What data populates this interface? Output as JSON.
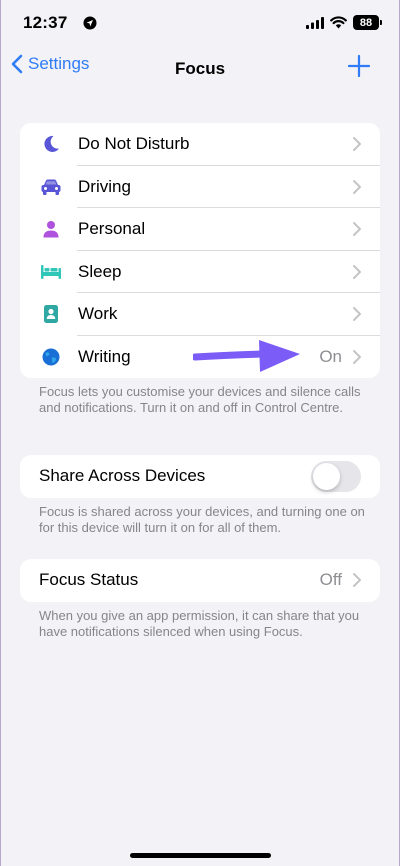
{
  "status_bar": {
    "time": "12:37",
    "battery": "88"
  },
  "nav": {
    "back_label": "Settings",
    "title": "Focus"
  },
  "modes": [
    {
      "label": "Do Not Disturb",
      "icon": "moon-icon",
      "color": "#5856d6",
      "value": ""
    },
    {
      "label": "Driving",
      "icon": "car-icon",
      "color": "#5856d6",
      "value": ""
    },
    {
      "label": "Personal",
      "icon": "person-icon",
      "color": "#af52de",
      "value": ""
    },
    {
      "label": "Sleep",
      "icon": "bed-icon",
      "color": "#30c7b8",
      "value": ""
    },
    {
      "label": "Work",
      "icon": "badge-icon",
      "color": "#2fa7a3",
      "value": ""
    },
    {
      "label": "Writing",
      "icon": "globe-icon",
      "color": "#1a6fd6",
      "value": "On"
    }
  ],
  "modes_footer": "Focus lets you customise your devices and silence calls and notifications. Turn it on and off in Control Centre.",
  "share": {
    "label": "Share Across Devices",
    "enabled": false
  },
  "share_footer": "Focus is shared across your devices, and turning one on for this device will turn it on for all of them.",
  "focus_status": {
    "label": "Focus Status",
    "value": "Off"
  },
  "status_footer": "When you give an app permission, it can share that you have notifications silenced when using Focus.",
  "colors": {
    "accent": "#2f7cf6",
    "annotation_arrow": "#7b5cf6"
  }
}
